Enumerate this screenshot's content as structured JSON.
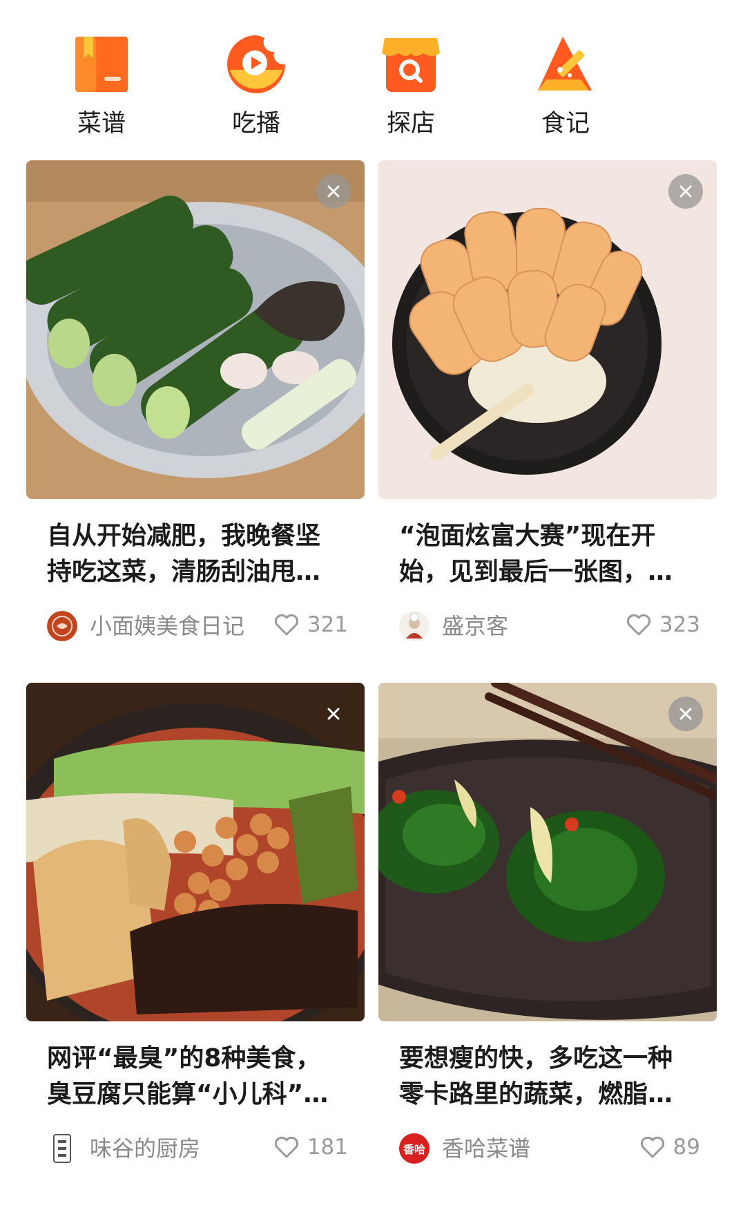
{
  "nav": [
    {
      "label": "菜谱",
      "icon": "recipe-book-icon"
    },
    {
      "label": "吃播",
      "icon": "eating-stream-play-icon"
    },
    {
      "label": "探店",
      "icon": "shop-search-icon"
    },
    {
      "label": "食记",
      "icon": "food-diary-pen-icon"
    }
  ],
  "accent_color": "#ff6a1a",
  "feed": [
    {
      "title": "自从开始减肥，我晚餐坚持吃这菜，清肠刮油甩…",
      "author": "小面姨美食日记",
      "likes": "321",
      "image": "cucumbers-garlic-plate"
    },
    {
      "title": "“泡面炫富大赛”现在开始，见到最后一张图，…",
      "author": "盛京客",
      "likes": "323",
      "image": "noodle-bowl-with-crackers"
    },
    {
      "title": "网评“最臭”的8种美食，臭豆腐只能算“小儿科”…",
      "author": "味谷的厨房",
      "likes": "181",
      "image": "spicy-noodles-peanuts"
    },
    {
      "title": "要想瘦的快，多吃这一种零卡路里的蔬菜，燃脂…",
      "author": "香哈菜谱",
      "likes": "89",
      "image": "spinach-plate-chopsticks",
      "avatar_text": "香哈"
    }
  ]
}
